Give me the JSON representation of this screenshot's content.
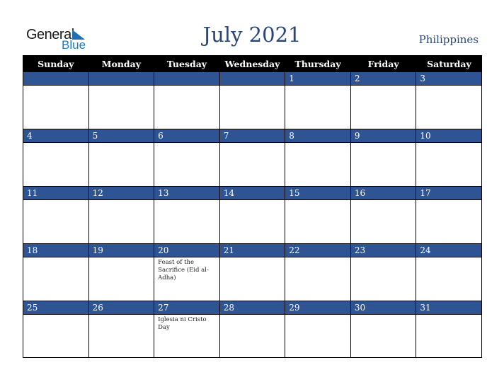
{
  "logo": {
    "line1": "General",
    "line2": "Blue"
  },
  "title": "July 2021",
  "country": "Philippines",
  "days_of_week": [
    "Sunday",
    "Monday",
    "Tuesday",
    "Wednesday",
    "Thursday",
    "Friday",
    "Saturday"
  ],
  "weeks": [
    [
      {
        "day": "",
        "event": ""
      },
      {
        "day": "",
        "event": ""
      },
      {
        "day": "",
        "event": ""
      },
      {
        "day": "",
        "event": ""
      },
      {
        "day": "1",
        "event": ""
      },
      {
        "day": "2",
        "event": ""
      },
      {
        "day": "3",
        "event": ""
      }
    ],
    [
      {
        "day": "4",
        "event": ""
      },
      {
        "day": "5",
        "event": ""
      },
      {
        "day": "6",
        "event": ""
      },
      {
        "day": "7",
        "event": ""
      },
      {
        "day": "8",
        "event": ""
      },
      {
        "day": "9",
        "event": ""
      },
      {
        "day": "10",
        "event": ""
      }
    ],
    [
      {
        "day": "11",
        "event": ""
      },
      {
        "day": "12",
        "event": ""
      },
      {
        "day": "13",
        "event": ""
      },
      {
        "day": "14",
        "event": ""
      },
      {
        "day": "15",
        "event": ""
      },
      {
        "day": "16",
        "event": ""
      },
      {
        "day": "17",
        "event": ""
      }
    ],
    [
      {
        "day": "18",
        "event": ""
      },
      {
        "day": "19",
        "event": ""
      },
      {
        "day": "20",
        "event": "Feast of the Sacrifice (Eid al-Adha)"
      },
      {
        "day": "21",
        "event": ""
      },
      {
        "day": "22",
        "event": ""
      },
      {
        "day": "23",
        "event": ""
      },
      {
        "day": "24",
        "event": ""
      }
    ],
    [
      {
        "day": "25",
        "event": ""
      },
      {
        "day": "26",
        "event": ""
      },
      {
        "day": "27",
        "event": "Iglesia ni Cristo Day"
      },
      {
        "day": "28",
        "event": ""
      },
      {
        "day": "29",
        "event": ""
      },
      {
        "day": "30",
        "event": ""
      },
      {
        "day": "31",
        "event": ""
      }
    ]
  ]
}
